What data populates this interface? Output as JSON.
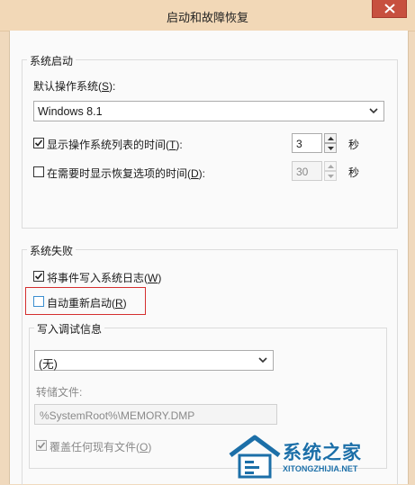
{
  "window": {
    "title": "启动和故障恢复"
  },
  "system_startup": {
    "legend": "系统启动",
    "default_os_label_prefix": "默认操作系统(",
    "default_os_label_key": "S",
    "default_os_label_suffix": "):",
    "default_os_value": "Windows 8.1",
    "show_list_label_prefix": "显示操作系统列表的时间(",
    "show_list_label_key": "T",
    "show_list_label_suffix": "):",
    "show_list_checked": true,
    "show_list_seconds": "3",
    "show_recovery_label_prefix": "在需要时显示恢复选项的时间(",
    "show_recovery_label_key": "D",
    "show_recovery_label_suffix": "):",
    "show_recovery_checked": false,
    "show_recovery_seconds": "30",
    "seconds_unit": "秒"
  },
  "system_failure": {
    "legend": "系统失败",
    "write_log_label_prefix": "将事件写入系统日志(",
    "write_log_label_key": "W",
    "write_log_label_suffix": ")",
    "write_log_checked": true,
    "auto_restart_label_prefix": "自动重新启动(",
    "auto_restart_label_key": "R",
    "auto_restart_label_suffix": ")",
    "auto_restart_checked": false,
    "highlight_color": "#d42e2e",
    "debug_info": {
      "legend": "写入调试信息",
      "dropdown_value": "(无)",
      "dump_file_label": "转储文件:",
      "dump_file_value": "%SystemRoot%\\MEMORY.DMP",
      "overwrite_label_prefix": "覆盖任何现有文件(",
      "overwrite_label_key": "O",
      "overwrite_label_suffix": ")",
      "overwrite_checked": true
    }
  },
  "watermark": {
    "text": "系统之家",
    "url": "XITONGZHIJIA.NET",
    "color": "#1c6fa8"
  },
  "icons": {
    "close": "close-icon",
    "dropdown": "chevron-down-icon",
    "spin_up": "spin-up-icon",
    "spin_down": "spin-down-icon",
    "check": "checkmark-icon"
  }
}
